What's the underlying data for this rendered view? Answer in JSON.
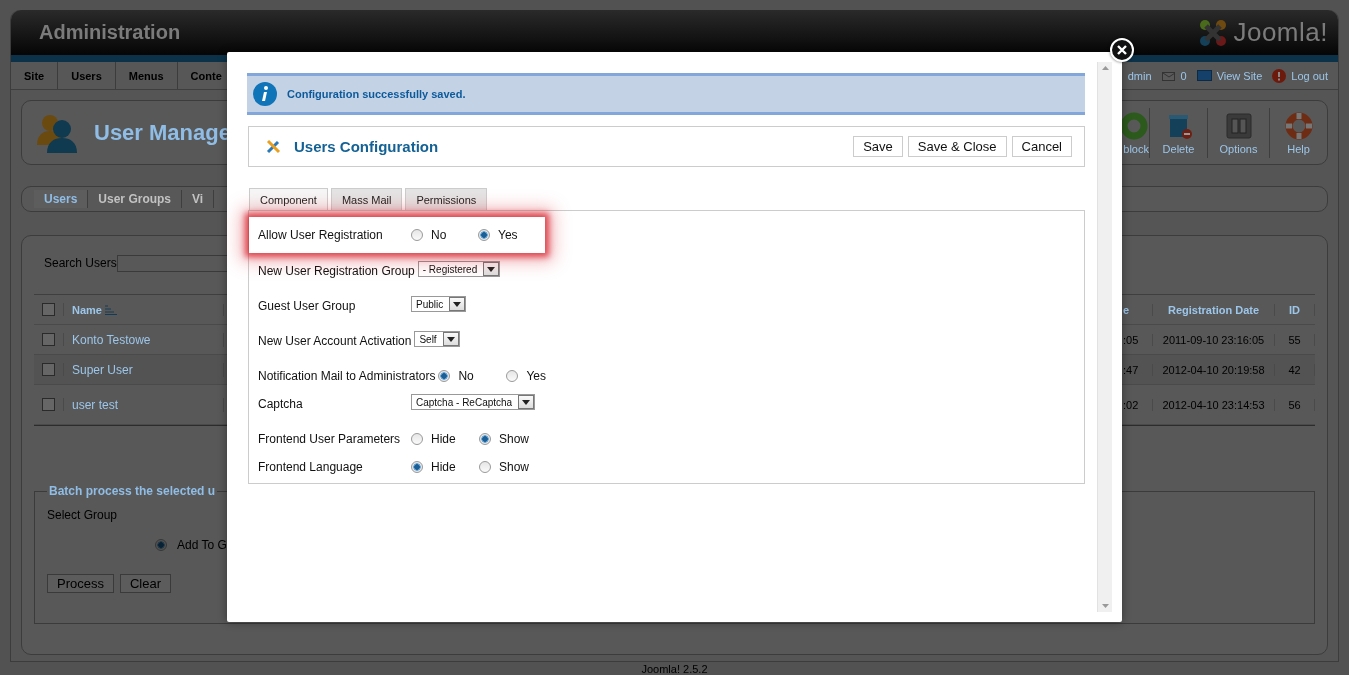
{
  "header": {
    "title": "Administration",
    "logo": "Joomla!"
  },
  "menu": {
    "items": [
      "Site",
      "Users",
      "Menus",
      "Conte"
    ],
    "status": [
      {
        "kind": "user",
        "text": "dmin"
      },
      {
        "kind": "messages",
        "text": "0"
      },
      {
        "kind": "site",
        "text": "View Site"
      },
      {
        "kind": "logout",
        "text": "Log out"
      }
    ]
  },
  "toolbar": {
    "title": "User Manage",
    "buttons": [
      {
        "kind": "unblock",
        "label": "block"
      },
      {
        "kind": "delete",
        "label": "Delete"
      },
      {
        "kind": "options",
        "label": "Options"
      },
      {
        "kind": "help",
        "label": "Help"
      }
    ]
  },
  "submenu": [
    {
      "label": "Users",
      "selected": true
    },
    {
      "label": "User Groups",
      "selected": false
    },
    {
      "label": "Vi",
      "selected": false
    }
  ],
  "search": {
    "label": "Search Users"
  },
  "table": {
    "select_all_checked": false,
    "columns": [
      "Name",
      "e",
      "Registration Date",
      "ID"
    ],
    "rows": [
      {
        "checked": false,
        "name": "Konto Testowe",
        "column_3": ":05",
        "registered": "2011-09-10 23:16:05",
        "id": "55"
      },
      {
        "checked": false,
        "name": "Super User",
        "column_3": ":47",
        "registered": "2012-04-10 20:19:58",
        "id": "42"
      },
      {
        "checked": false,
        "name": "user test",
        "column_3": ":02",
        "registered": "2012-04-10 23:14:53",
        "id": "56"
      }
    ]
  },
  "batch": {
    "legend": "Batch process the selected u",
    "select_label": "Select Group",
    "option": {
      "label": "Add To G",
      "selected": true
    },
    "buttons": [
      "Process",
      "Clear"
    ]
  },
  "footer": "Joomla! 2.5.2",
  "dialog": {
    "message": "Configuration successfully saved.",
    "title": "Users Configuration",
    "buttons": [
      "Save",
      "Save & Close",
      "Cancel"
    ],
    "tabs": [
      {
        "label": "Component",
        "selected": true
      },
      {
        "label": "Mass Mail",
        "selected": false
      },
      {
        "label": "Permissions",
        "selected": false
      }
    ],
    "fields": [
      {
        "kind": "radio",
        "label": "Allow User Registration",
        "highlighted": true,
        "options": [
          {
            "label": "No",
            "selected": false
          },
          {
            "label": "Yes",
            "selected": true
          }
        ]
      },
      {
        "kind": "select",
        "label": "New User Registration Group",
        "value": "- Registered"
      },
      {
        "kind": "select",
        "label": "Guest User Group",
        "value": "Public"
      },
      {
        "kind": "select",
        "label": "New User Account Activation",
        "value": "Self"
      },
      {
        "kind": "radio",
        "label": "Notification Mail to Administrators",
        "options": [
          {
            "label": "No",
            "selected": true
          },
          {
            "label": "Yes",
            "selected": false
          }
        ]
      },
      {
        "kind": "select",
        "label": "Captcha",
        "value": "Captcha - ReCaptcha"
      },
      {
        "kind": "radio",
        "label": "Frontend User Parameters",
        "options": [
          {
            "label": "Hide",
            "selected": false
          },
          {
            "label": "Show",
            "selected": true
          }
        ]
      },
      {
        "kind": "radio",
        "label": "Frontend Language",
        "options": [
          {
            "label": "Hide",
            "selected": true
          },
          {
            "label": "Show",
            "selected": false
          }
        ]
      }
    ]
  }
}
